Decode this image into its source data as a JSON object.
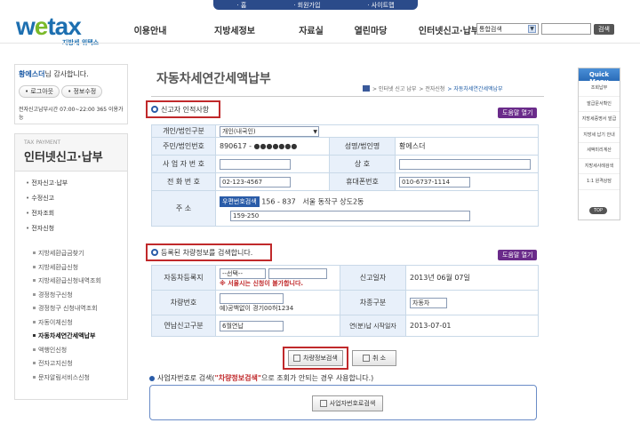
{
  "topbar": {
    "home": "· 홈",
    "join": "· 회원가입",
    "sitemap": "· 사이트맵"
  },
  "logo": {
    "text_a": "w",
    "text_e": "e",
    "text_b": "tax",
    "sub": "지방세 위택스"
  },
  "gnb": {
    "items": [
      "이용안내",
      "지방세정보",
      "자료실",
      "열린마당",
      "인터넷신고·납부"
    ],
    "search_select": "통합검색",
    "search_button": "검색"
  },
  "login": {
    "user": "황에스더",
    "greeting": "님 감사합니다.",
    "logout": "• 로그아웃",
    "info_edit": "• 정보수정",
    "hours": "전자신고납부시간 07:00~22:00 365 이용가능"
  },
  "side": {
    "en_title": "TAX PAYMENT",
    "title": "인터넷신고·납부",
    "main_items": [
      "전자신고·납부",
      "수정신고",
      "전자조회",
      "전자신청"
    ],
    "sub_items": [
      "지방세환급금찾기",
      "지방세환급신청",
      "지방세환급신청내역조회",
      "경정청구신청",
      "경정청구 신청내역조회",
      "자동이체신청",
      "자동차세연간세액납부",
      "액행인신청",
      "전자고지신청",
      "문자알림서비스신청"
    ],
    "active_index": 6
  },
  "page": {
    "title": "자동차세연간세액납부",
    "breadcrumb": [
      "> 인터넷 신고 납부",
      "> 전자신청",
      "> 자동차세연간세액납부"
    ]
  },
  "section1": {
    "title": "신고자 인적사항",
    "help": "도움말 열기",
    "type_label": "개인/법인구분",
    "type_value": "개인(내국인)",
    "id_label": "주민/법인번호",
    "id_value": "890617 - ●●●●●●●",
    "name_label": "성명/법인명",
    "name_value": "황에스더",
    "biz_label": "사 업 자 번 호",
    "trade_label": "상 호",
    "phone_label": "전 화 번 호",
    "phone_value": "02-123-4567",
    "mobile_label": "휴대폰번호",
    "mobile_value": "010-6737-1114",
    "addr_label": "주 소",
    "zip_button": "우편번호검색",
    "zip_value": "156 - 837",
    "addr1": "서울 동작구 상도2동",
    "addr2": "159-250"
  },
  "section2": {
    "title": "등록된 차량정보를 검색합니다.",
    "help": "도움말 열기",
    "region_label": "자동차등록지",
    "region_select": "--선택--",
    "region_warn": "※ 서울시는 신청이 불가합니다.",
    "report_date_label": "신고일자",
    "report_date_value": "2013년 06월 07일",
    "car_no_label": "차량번호",
    "car_no_example": "예)공백없이 경기00허1234",
    "car_type_label": "차종구분",
    "car_type_value": "자동차",
    "annual_label": "연납신고구분",
    "annual_value": "6월연납",
    "start_label": "연(분)납 시작일자",
    "start_value": "2013-07-01"
  },
  "buttons": {
    "search_car": "차량정보검색",
    "cancel": "취 소",
    "biz_search": "사업자번호로검색"
  },
  "note": {
    "pre": "사업자번호로 검색(",
    "em": "\"차량정보검색\"",
    "post": "으로 조회가 안되는 경우 사용합니다.)"
  },
  "quick": {
    "title": "Quick Menu",
    "items": [
      "조회납부",
      "발급문서확인",
      "지방세증명서 발급",
      "지방세 납기 안내",
      "세액미리계산",
      "지방세사례검색",
      "1:1 원격상담"
    ],
    "top": "TOP"
  }
}
